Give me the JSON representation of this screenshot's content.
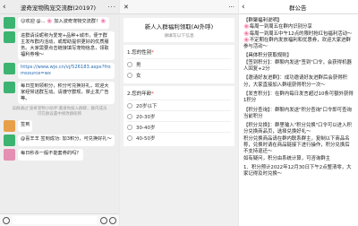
{
  "chat": {
    "title": "波奇宠物购宠交流群(20197)",
    "messages": [
      {
        "type": "bubble",
        "avatar": "green",
        "text": "😊欢迎 @... 🌸 加入波奇宠物交流群！🌸"
      },
      {
        "type": "bubble",
        "avatar": "green",
        "text": "进群请设昵称为爱宠+品种+城市，便于群主发布群内活动，或帮助提供更好的优质服务。大家需要点击链接填写宠物信息，领取福利券哦～"
      },
      {
        "type": "link",
        "avatar": "green",
        "text": "https://www.wjx.cn/vj/526183.aspx?fromsource=wx"
      },
      {
        "type": "bubble",
        "avatar": "green",
        "text": "每日签到领积分，积分可兑换好礼，欢迎大家经常进群互动。请遵守群规，禁止发广告等。"
      },
      {
        "type": "system",
        "text": "该群通过'波奇宠物小助手'邀请你加入群聊，群内成员可在群设置中修改群昵称"
      },
      {
        "type": "bubble",
        "avatar": "orange",
        "text": "签到"
      },
      {
        "type": "bubble",
        "avatar": "green",
        "text": "@喜羊羊 签到成功: 加3积分，可兑换好礼～"
      },
      {
        "type": "bubble",
        "avatar": "pink",
        "text": "每日秒杀一般不能套券的吗？"
      }
    ]
  },
  "form": {
    "header_left": "✕",
    "header_right": "···",
    "title": "新人入群福利领取(AI外呼)",
    "desc": "请填写以下信息",
    "q1": {
      "label": "1.您的性别",
      "required": "*",
      "options": [
        "男",
        "女"
      ]
    },
    "q2": {
      "label": "2.您的年龄",
      "required": "*",
      "options": [
        "20岁以下",
        "20-30岁",
        "30-40岁",
        "40-50岁"
      ]
    }
  },
  "notice": {
    "title": "群公告",
    "lines": [
      "【群聚福利说明】",
      "🌸每周一到周五在群内识别分享",
      "🌸每周一到周五中午12点的限时抢红包福利活动～",
      "🌸不定期在群内发放福利和优惠券，欢迎大家进群参与活动～",
      "【具体积分获取规则】",
      "【签到积分】：群聊内发送\"签到\"口令，会获得机器人回复+2分",
      "【邀请好友进群】：成功邀请好友进群后会获得积分，大家直接加入群组获得积分一次～",
      "【发言积分】：在群内每日发言超过10条可额外获得1积分",
      "【积分查询】：群聊内发送\"积分查询\"口令即可查询当前积分",
      "【积分兑换】：群里输入\"积分兑换\"口令可以进入积分兑换商品页，选择兑换好礼～",
      "积分兑换商品请在群内联系群主，复制以下商品名称，兑换时请在商品链接下进行操作，积分兑换后不支持退还～",
      "如有疑问，积分由系统计算，可咨询群主",
      "1、积分预计2022年12月30日下午2点整清零，大家记得及时兑换～"
    ]
  }
}
